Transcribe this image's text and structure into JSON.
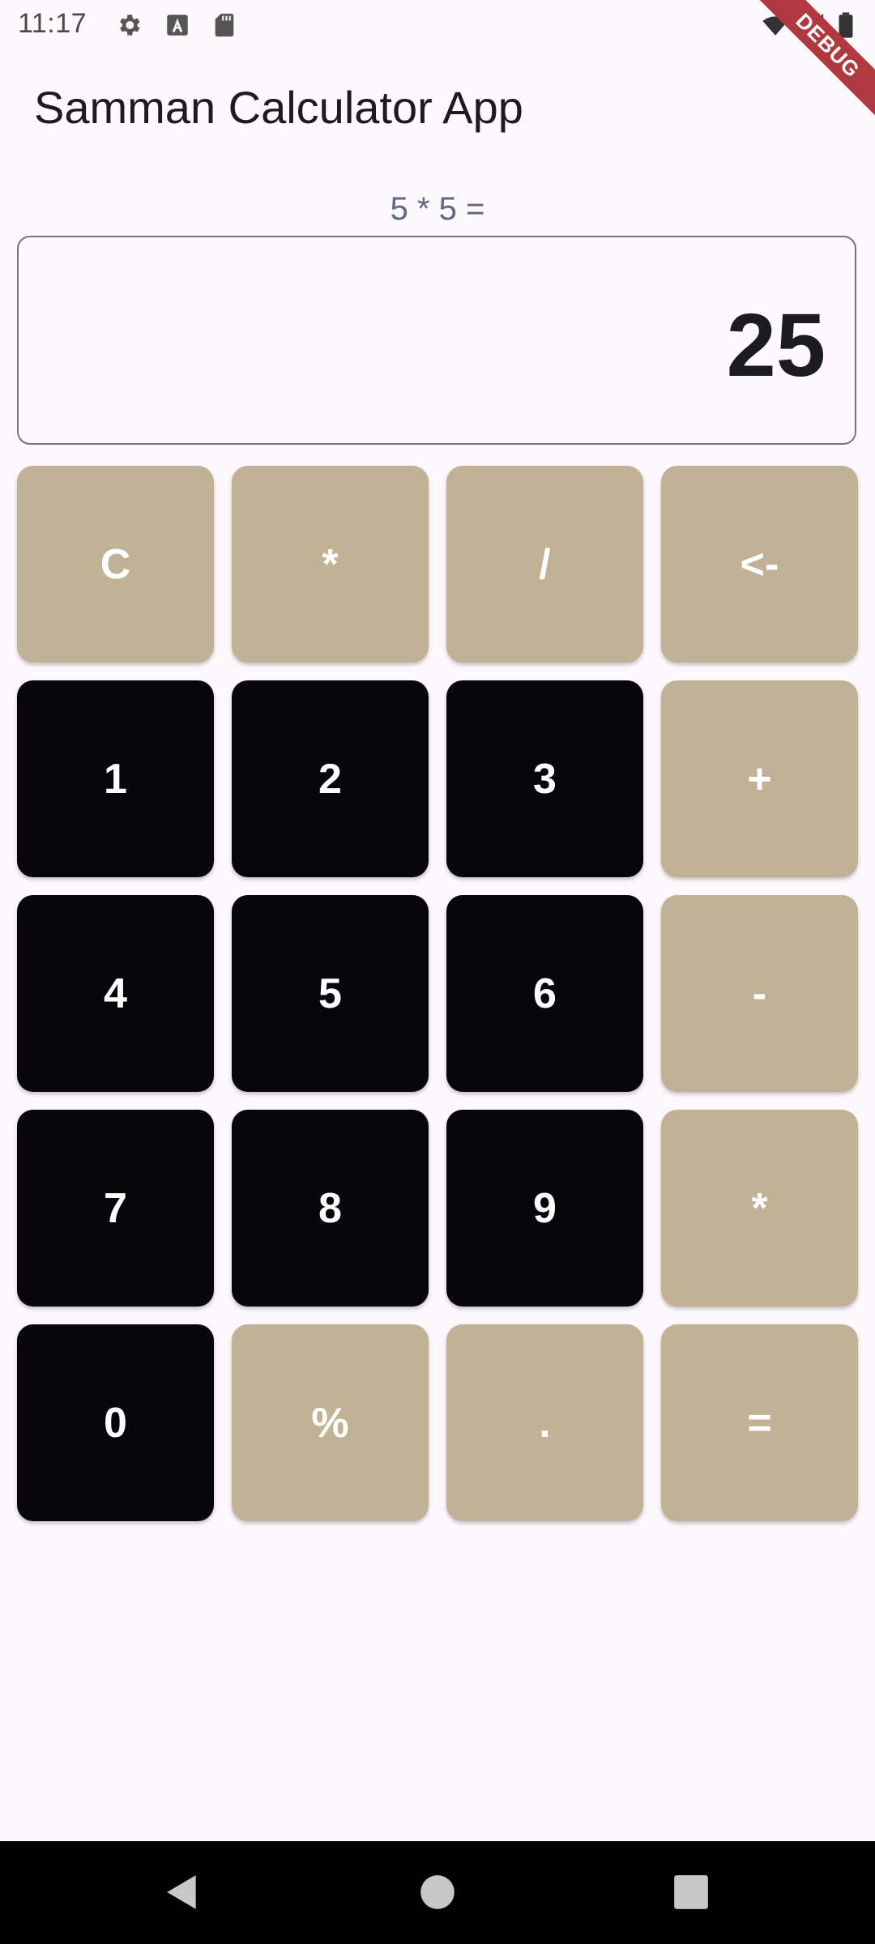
{
  "status_bar": {
    "time": "11:17",
    "icons": [
      "settings-icon",
      "text-a-icon",
      "sd-card-icon",
      "wifi-icon",
      "signal-icon",
      "battery-icon"
    ]
  },
  "debug_banner": {
    "label": "DEBUG"
  },
  "app_bar": {
    "title": "Samman Calculator App"
  },
  "calculator": {
    "expression": "5 * 5 =",
    "result": "25"
  },
  "keypad": {
    "keys": [
      {
        "label": "C",
        "style": "light"
      },
      {
        "label": "*",
        "style": "light"
      },
      {
        "label": "/",
        "style": "light"
      },
      {
        "label": "<-",
        "style": "light"
      },
      {
        "label": "1",
        "style": "dark"
      },
      {
        "label": "2",
        "style": "dark"
      },
      {
        "label": "3",
        "style": "dark"
      },
      {
        "label": "+",
        "style": "light"
      },
      {
        "label": "4",
        "style": "dark"
      },
      {
        "label": "5",
        "style": "dark"
      },
      {
        "label": "6",
        "style": "dark"
      },
      {
        "label": "-",
        "style": "light"
      },
      {
        "label": "7",
        "style": "dark"
      },
      {
        "label": "8",
        "style": "dark"
      },
      {
        "label": "9",
        "style": "dark"
      },
      {
        "label": "*",
        "style": "light"
      },
      {
        "label": "0",
        "style": "dark"
      },
      {
        "label": "%",
        "style": "light"
      },
      {
        "label": ".",
        "style": "light"
      },
      {
        "label": "=",
        "style": "light"
      }
    ]
  },
  "colors": {
    "background": "#fdf8fb",
    "key_dark": "#07060b",
    "key_light": "#c2b295",
    "expression": "#5e6783",
    "debug_banner": "#b0383f"
  },
  "nav_bar": {
    "buttons": [
      "back-icon",
      "home-icon",
      "recents-icon"
    ]
  }
}
